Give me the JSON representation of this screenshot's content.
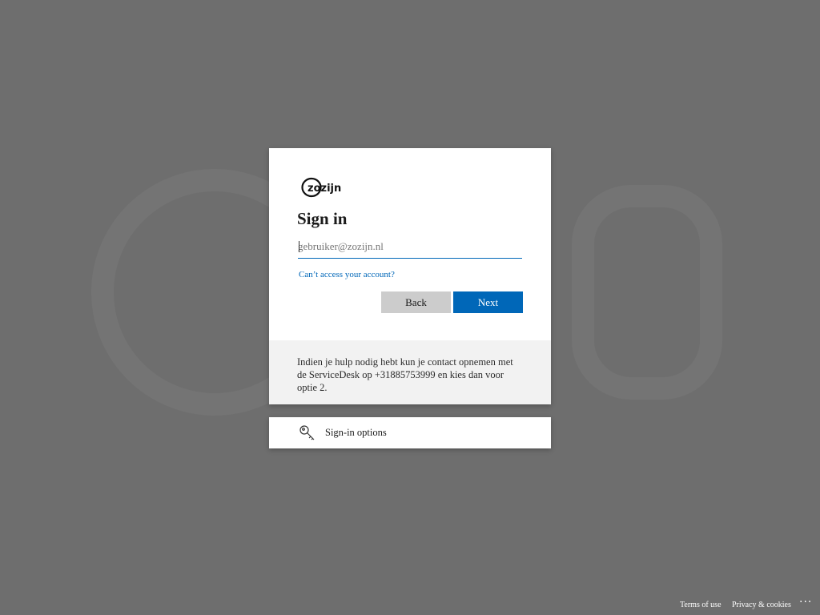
{
  "logo": {
    "text": "zozijn",
    "icon": "zozijn-logo"
  },
  "signin": {
    "title": "Sign in",
    "email_value": "",
    "email_placeholder": "gebruiker@zozijn.nl",
    "help_link": "Can’t access your account?",
    "back_label": "Back",
    "next_label": "Next"
  },
  "info": {
    "text": "Indien je hulp nodig hebt kun je contact opnemen met de ServiceDesk op +31885753999 en kies dan voor optie 2."
  },
  "options": {
    "label": "Sign-in options",
    "icon": "key-icon"
  },
  "footer": {
    "terms": "Terms of use",
    "privacy": "Privacy & cookies",
    "more": "···"
  },
  "colors": {
    "background": "#6e6e6e",
    "accent": "#0067b8",
    "back_button": "#cccccc",
    "info_panel": "#f2f2f2"
  }
}
